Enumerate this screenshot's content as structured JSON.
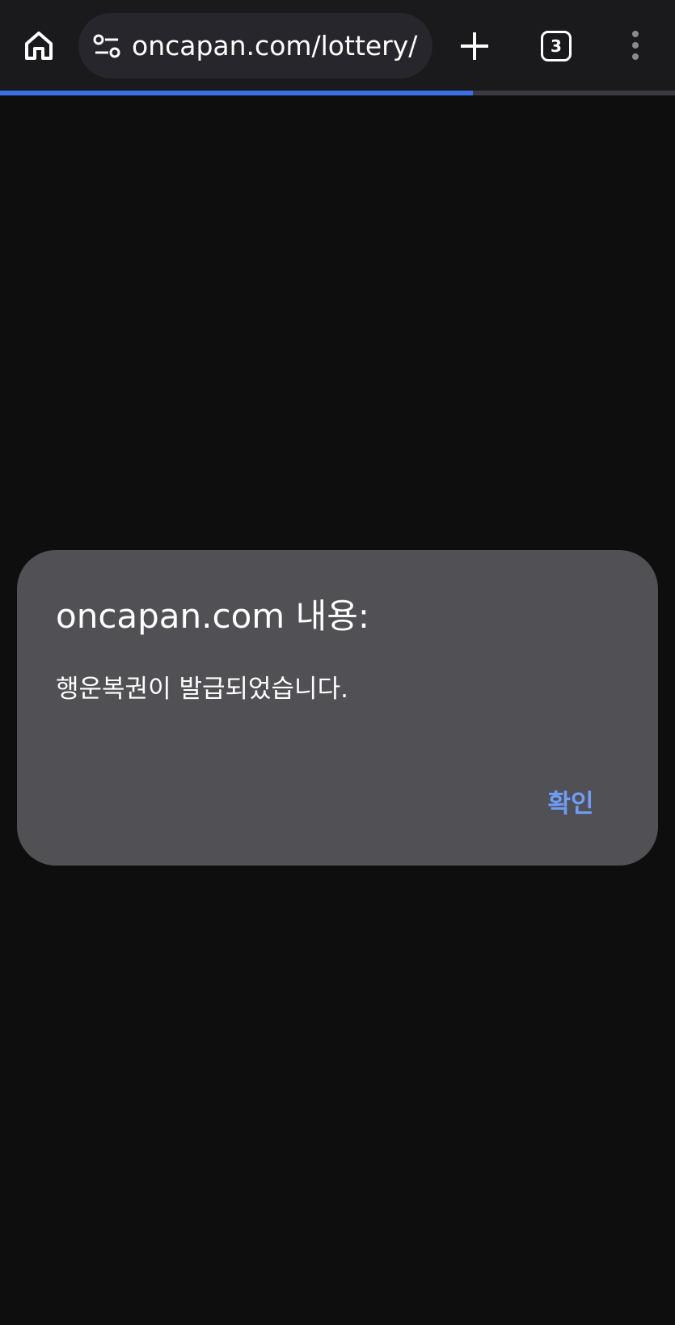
{
  "browser": {
    "url": "oncapan.com/lottery/",
    "tab_count": "3",
    "load_progress": 0.7,
    "icons": {
      "home": "home-icon",
      "site_info": "site-settings-icon",
      "new_tab": "plus-icon",
      "menu": "more-vertical-icon"
    },
    "accent_color": "#3b6fe6"
  },
  "dialog": {
    "title": "oncapan.com 내용:",
    "message": "행운복권이 발급되었습니다.",
    "ok_label": "확인",
    "button_color": "#6e9cf7",
    "background_color": "#505055"
  }
}
